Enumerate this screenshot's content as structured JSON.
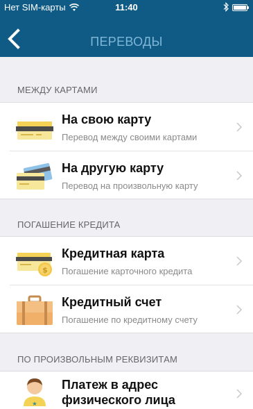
{
  "status_bar": {
    "carrier": "Нет SIM-карты",
    "time": "11:40"
  },
  "nav": {
    "title": "ПЕРЕВОДЫ"
  },
  "sections": [
    {
      "label": "МЕЖДУ КАРТАМИ",
      "items": [
        {
          "title": "На свою карту",
          "subtitle": "Перевод между своими картами",
          "icon": "card-icon"
        },
        {
          "title": "На другую карту",
          "subtitle": "Перевод на произвольную карту",
          "icon": "cards-icon"
        }
      ]
    },
    {
      "label": "ПОГАШЕНИЕ КРЕДИТА",
      "items": [
        {
          "title": "Кредитная карта",
          "subtitle": "Погашение карточного кредита",
          "icon": "card-coin-icon"
        },
        {
          "title": "Кредитный счет",
          "subtitle": "Погашение по кредитному счету",
          "icon": "briefcase-icon"
        }
      ]
    },
    {
      "label": "ПО ПРОИЗВОЛЬНЫМ РЕКВИЗИТАМ",
      "items": [
        {
          "title": "Платеж в адрес физического лица",
          "icon": "person-icon"
        }
      ]
    }
  ],
  "colors": {
    "header": "#0f5b86",
    "background": "#efeff4",
    "title_faded": "#7fb6d6"
  }
}
